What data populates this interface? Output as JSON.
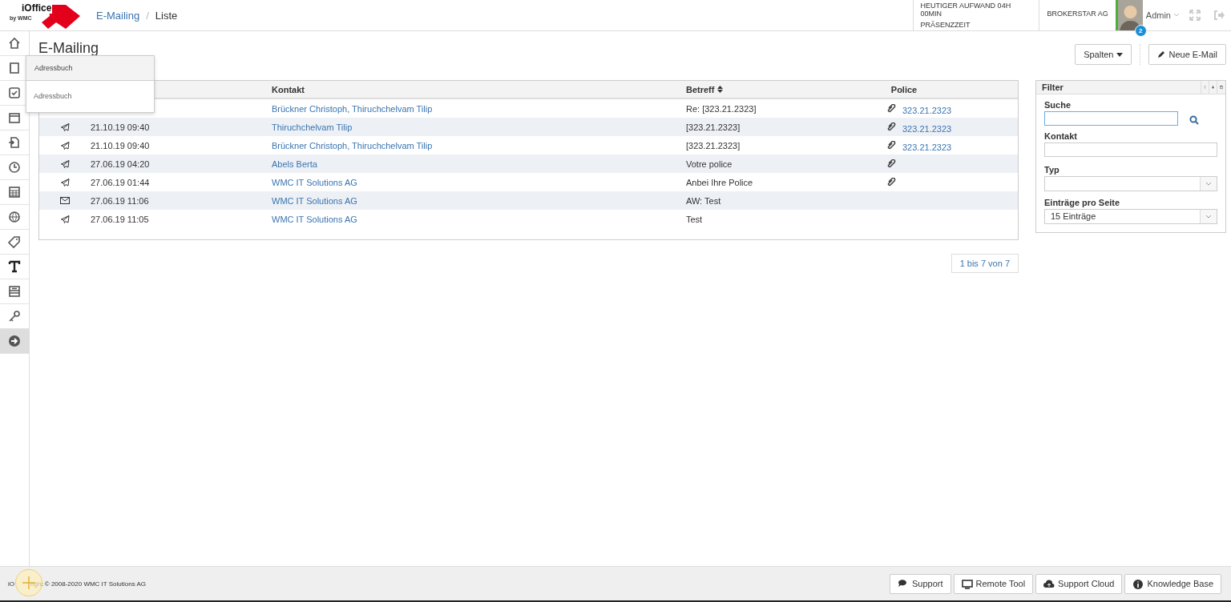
{
  "logo": {
    "name": "iOffice",
    "byline": "by WMC"
  },
  "breadcrumb_separator": "/",
  "breadcrumb": [
    {
      "label": "E-Mailing",
      "link": true
    },
    {
      "label": "Liste",
      "link": false
    }
  ],
  "header_stats": [
    "HEUTIGER AUFWAND 04H 00MIN",
    "PRÄSENZZEIT"
  ],
  "company": "BROKERSTAR AG",
  "user": {
    "name": "Admin",
    "badge": "2"
  },
  "sidebar": [
    {
      "kind": "home",
      "highlighted": false
    },
    {
      "kind": "notebook",
      "highlighted": false
    },
    {
      "kind": "check",
      "highlighted": false
    },
    {
      "kind": "calendar",
      "highlighted": false
    },
    {
      "kind": "document",
      "highlighted": false
    },
    {
      "kind": "clock",
      "highlighted": false
    },
    {
      "kind": "grid",
      "highlighted": false
    },
    {
      "kind": "globe",
      "highlighted": false
    },
    {
      "kind": "tag",
      "highlighted": false
    },
    {
      "kind": "text",
      "highlighted": false
    },
    {
      "kind": "form",
      "highlighted": false
    },
    {
      "kind": "key",
      "highlighted": false
    },
    {
      "kind": "arrow",
      "highlighted": true
    }
  ],
  "page_title": "E-Mailing",
  "buttons": {
    "columns": "Spalten",
    "new": "Neue E-Mail"
  },
  "table": {
    "columns": [
      "Kontakt",
      "Betreff",
      "Police"
    ],
    "rows": [
      {
        "contact": "Brückner Christoph, Thiruchchelvam Tilip",
        "subject": "Re: [323.21.2323]",
        "attachment": true,
        "police": "323.21.2323"
      },
      {
        "kind": "sent",
        "date": "21.10.19 09:40",
        "contact": "Thiruchchelvam Tilip",
        "subject": "[323.21.2323]",
        "attachment": true,
        "police": "323.21.2323"
      },
      {
        "kind": "sent",
        "date": "21.10.19 09:40",
        "contact": "Brückner Christoph, Thiruchchelvam Tilip",
        "subject": "[323.21.2323]",
        "attachment": true,
        "police": "323.21.2323"
      },
      {
        "kind": "sent",
        "date": "27.06.19 04:20",
        "contact": "Abels Berta",
        "subject": "Votre police",
        "attachment": true
      },
      {
        "kind": "sent",
        "date": "27.06.19 01:44",
        "contact": "WMC IT Solutions AG",
        "subject": "Anbei Ihre Police",
        "attachment": true
      },
      {
        "kind": "received",
        "date": "27.06.19 11:06",
        "contact": "WMC IT Solutions AG",
        "subject": "AW: Test",
        "attachment": false
      },
      {
        "kind": "sent",
        "date": "27.06.19 11:05",
        "contact": "WMC IT Solutions AG",
        "subject": "Test",
        "attachment": false
      }
    ]
  },
  "pager": "1 bis 7 von 7",
  "filter": {
    "title": "Filter",
    "fields": [
      {
        "kind": "search",
        "label": "Suche"
      },
      {
        "kind": "text",
        "label": "Kontakt"
      },
      {
        "kind": "select",
        "label": "Typ"
      },
      {
        "kind": "select",
        "label": "Einträge pro Seite",
        "value": "15 Einträge"
      }
    ]
  },
  "dropdown": {
    "header": "Adressbuch",
    "items": [
      "Adressbuch"
    ]
  },
  "footer": {
    "copyright_start": "iO",
    "copyright_end": "right © 2008-2020 WMC IT Solutions AG",
    "buttons": [
      {
        "kind": "chat",
        "label": "Support"
      },
      {
        "kind": "monitor",
        "label": "Remote Tool"
      },
      {
        "kind": "cloud",
        "label": "Support Cloud"
      },
      {
        "kind": "info",
        "label": "Knowledge Base"
      }
    ]
  }
}
